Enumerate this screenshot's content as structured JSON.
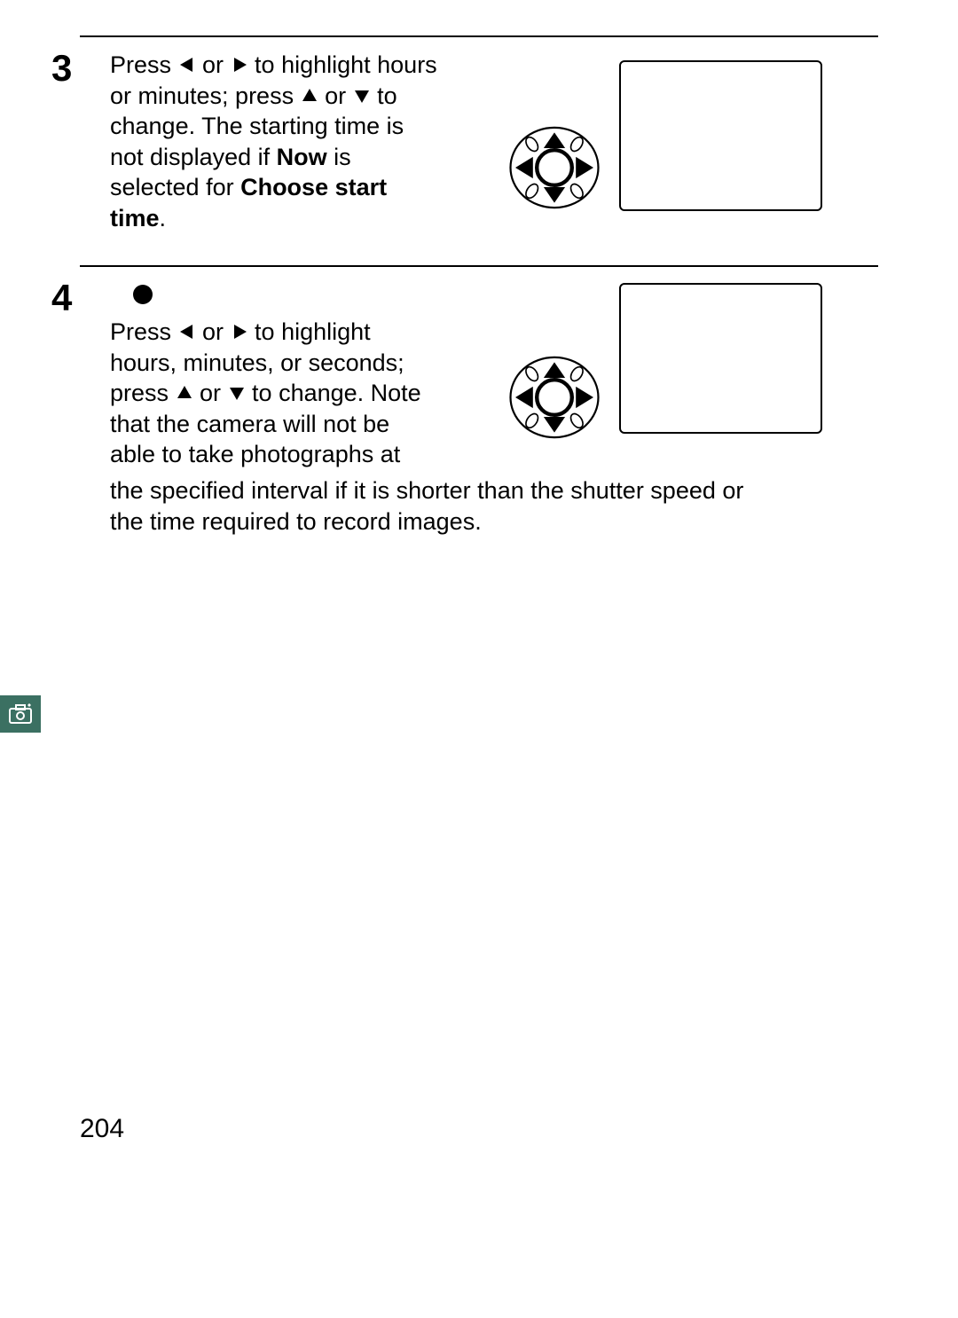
{
  "pageNumber": "204",
  "step1": {
    "number": "3",
    "text_part1": "Press ",
    "text_part2": " or ",
    "text_part3": " to highlight hours or minutes; press ",
    "text_part4": " or ",
    "text_part5": " to change.  The starting time is not displayed if ",
    "bold1": "Now",
    "text_part6": " is selected for ",
    "bold2": "Choose start time",
    "text_end": "."
  },
  "step2": {
    "number": "4",
    "text_part1": "Press ",
    "text_part2": " or ",
    "text_part3": " to highlight hours, minutes, or seconds; press ",
    "text_part4": " or ",
    "text_part5": " to change.  Note that the camera will not be able to take photographs at",
    "followOn": "the specified interval if it is shorter than the shutter speed or the time required to record images."
  }
}
